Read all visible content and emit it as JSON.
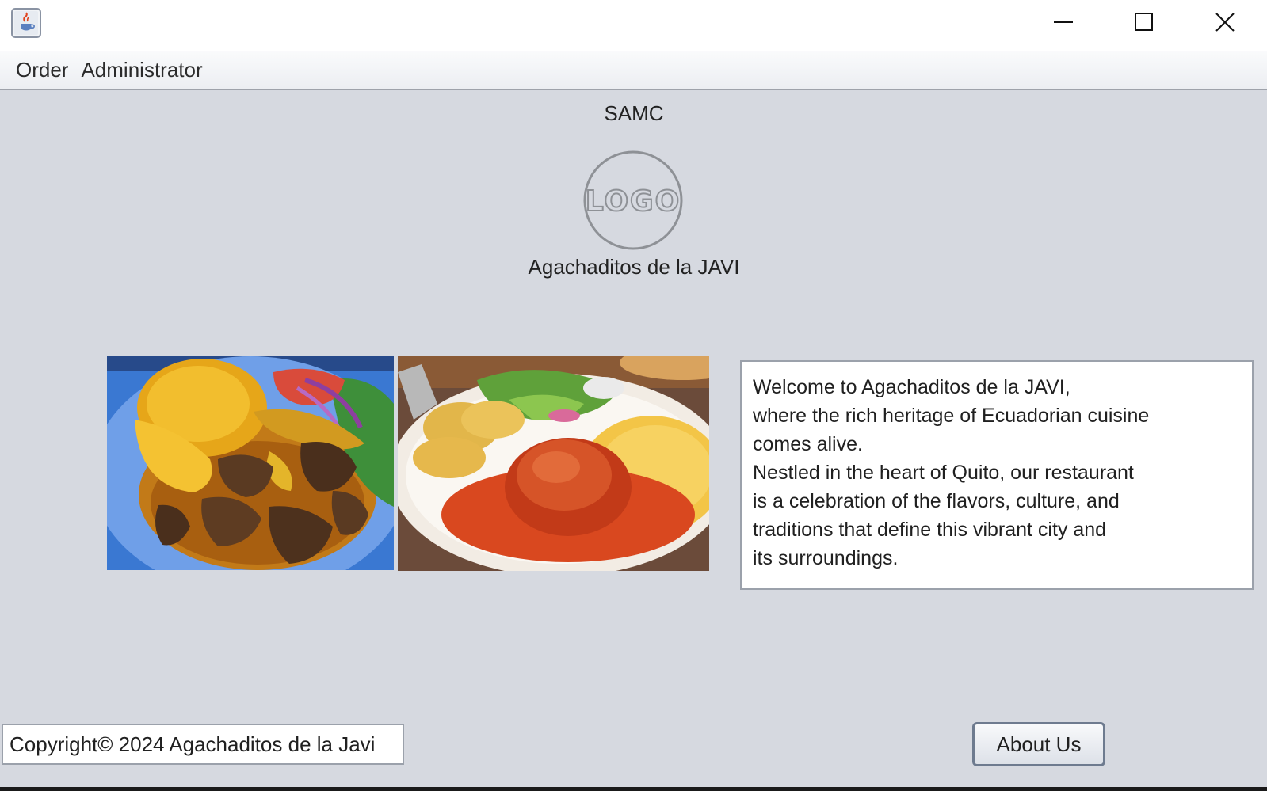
{
  "window": {
    "app_icon": "java-cup-icon",
    "controls": {
      "minimize": "minimize-icon",
      "maximize": "maximize-icon",
      "close": "close-icon"
    }
  },
  "menu": {
    "items": [
      {
        "label": "Order"
      },
      {
        "label": "Administrator"
      }
    ]
  },
  "header": {
    "title": "SAMC",
    "logo_text": "LOGO",
    "restaurant_name": "Agachaditos de la JAVI"
  },
  "images": [
    {
      "name": "food-photo-plate-rice-meat"
    },
    {
      "name": "food-photo-plate-chicken-rice"
    }
  ],
  "welcome": {
    "lines": [
      "Welcome to Agachaditos de la JAVI,",
      "where the rich heritage of Ecuadorian cuisine",
      "comes alive.",
      "Nestled in the heart of Quito, our restaurant",
      "is a celebration of the flavors, culture, and",
      "traditions that define this vibrant city and",
      "its surroundings."
    ]
  },
  "footer": {
    "copyright": "Copyright© 2024 Agachaditos de la Javi",
    "about_button": "About Us"
  },
  "colors": {
    "background": "#d6d9e0",
    "border": "#9ba1ab",
    "button_border": "#6e7b8f"
  }
}
